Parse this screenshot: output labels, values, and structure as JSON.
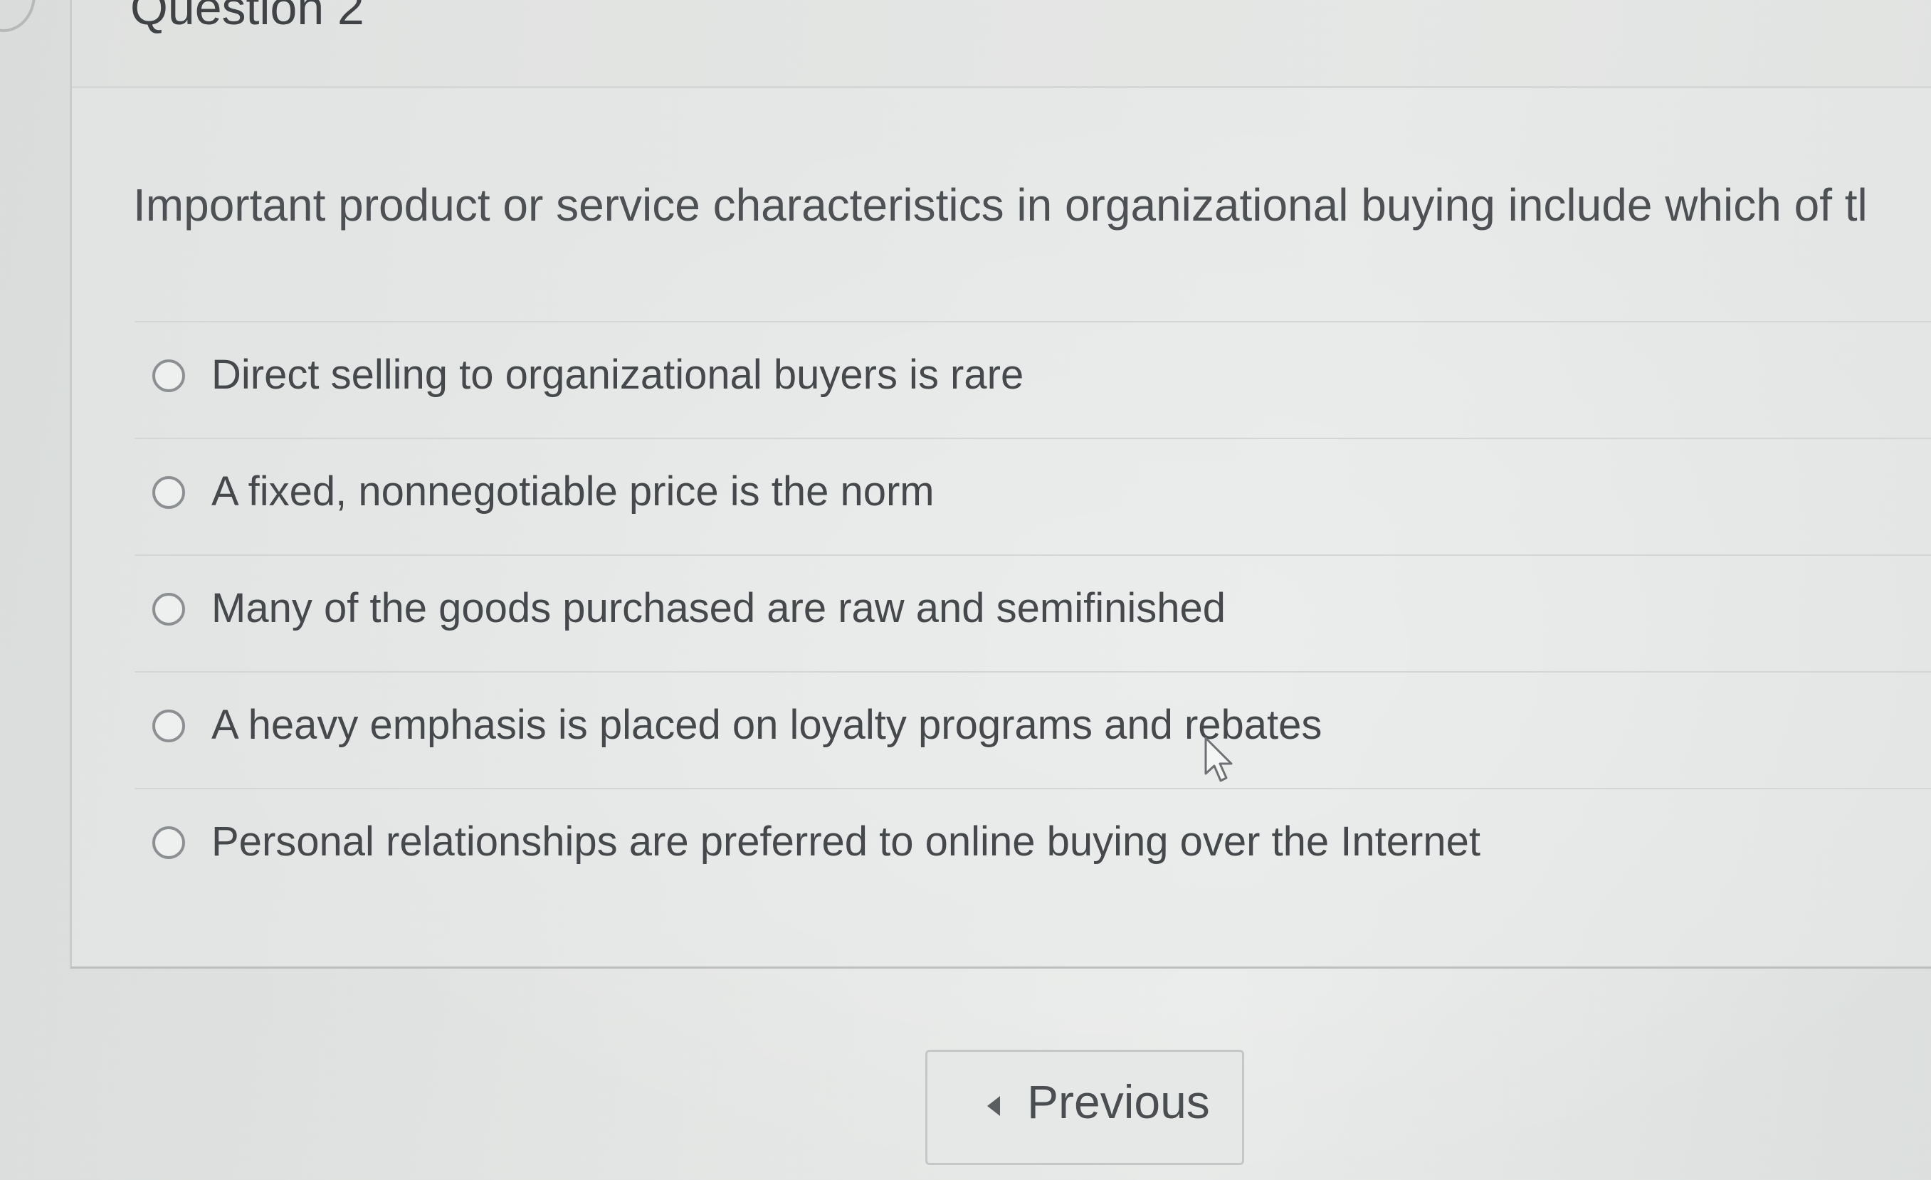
{
  "question": {
    "title": "Question 2",
    "text": "Important product or service characteristics in organizational buying include which of tl"
  },
  "answers": [
    {
      "label": "Direct selling to organizational buyers is rare",
      "selected": false
    },
    {
      "label": "A fixed, nonnegotiable price is the norm",
      "selected": false
    },
    {
      "label": "Many of the goods purchased are raw and semifinished",
      "selected": false
    },
    {
      "label": "A heavy emphasis is placed on loyalty programs and rebates",
      "selected": false
    },
    {
      "label": "Personal relationships are preferred to online buying over the Internet",
      "selected": false
    }
  ],
  "navigation": {
    "previous_label": "Previous",
    "previous_icon": "caret-left-icon"
  },
  "colors": {
    "text": "#45494b",
    "border": "#c9cccb",
    "background": "#e2e4e3"
  }
}
